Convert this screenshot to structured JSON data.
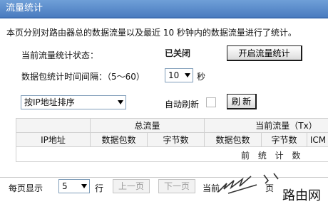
{
  "title": "流量统计",
  "intro": "本页分别对路由器总的数据流量以及最近 10 秒钟内的数据流量进行了统计。",
  "status": {
    "label": "当前流量统计状态：",
    "value": "已关闭",
    "toggle_button": "开启流量统计"
  },
  "interval": {
    "label": "数据包统计时间间隔：（5～60）",
    "value": "10",
    "unit": "秒"
  },
  "sort": {
    "selected": "按IP地址排序"
  },
  "auto_refresh": {
    "label": "自动刷新",
    "checked": false
  },
  "refresh_button": "刷 新",
  "table": {
    "group_total": "总流量",
    "group_current": "当前流量（Tx）",
    "columns": [
      "IP地址",
      "数据包数",
      "字节数",
      "数据包数",
      "字节数",
      "ICM"
    ],
    "empty_message": "前 统 计 数"
  },
  "pager": {
    "per_page_label": "每页显示",
    "per_page_value": "5",
    "rows_unit": "行",
    "prev_button": "上一页",
    "next_button": "下一页",
    "current_label": "当前",
    "page_suffix": "页"
  },
  "watermark": "路由网"
}
